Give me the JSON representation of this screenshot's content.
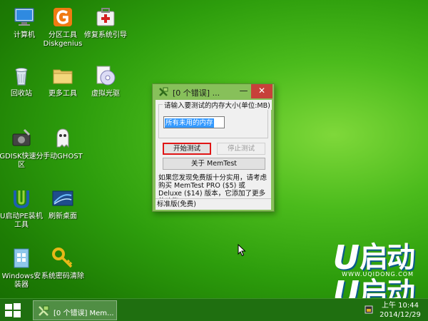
{
  "desktop": {
    "icons": [
      {
        "name": "computer-icon",
        "label": "计算机"
      },
      {
        "name": "diskgenius-icon",
        "label": "分区工具 Diskgenius"
      },
      {
        "name": "boot-repair-icon",
        "label": "修复系统引导"
      },
      {
        "name": "recycle-bin-icon",
        "label": "回收站"
      },
      {
        "name": "more-tools-folder-icon",
        "label": "更多工具"
      },
      {
        "name": "virtual-drive-icon",
        "label": "虚拟光驱"
      },
      {
        "name": "gdisk-icon",
        "label": "GDISK快速分区"
      },
      {
        "name": "ghost-icon",
        "label": "手动GHOST"
      },
      {
        "name": "uqidong-pe-icon",
        "label": "U启动PE装机工具"
      },
      {
        "name": "refresh-desktop-icon",
        "label": "刷新桌面"
      },
      {
        "name": "windows-install-icon",
        "label": "Windows安装器"
      },
      {
        "name": "password-clear-icon",
        "label": "系统密码清除"
      }
    ]
  },
  "brand": {
    "logo_letter": "U",
    "logo_text": "启动",
    "url": "WWW.UQIDONG.COM"
  },
  "window": {
    "title": "[0 个错误] ...",
    "minimize_glyph": "—",
    "close_glyph": "✕",
    "group_label": "请输入要测试的内存大小(单位:MB)",
    "input_value": "所有未用的内存",
    "start_button": "开始测试",
    "stop_button": "停止测试",
    "about_button": "关于 MemTest",
    "info_text": "如果您发现免费版十分实用，请考虑购买 MemTest PRO ($5) 或 Deluxe ($14) 版本，它添加了更多的功能。",
    "status": "标准版(免费)"
  },
  "taskbar": {
    "task_label": "[0 个错误] Mem...",
    "clock_time": "上午 10:44",
    "clock_date": "2014/12/29"
  },
  "colors": {
    "close_red": "#c7413a",
    "highlight_red": "#e01515",
    "selection_blue": "#3399ff"
  }
}
